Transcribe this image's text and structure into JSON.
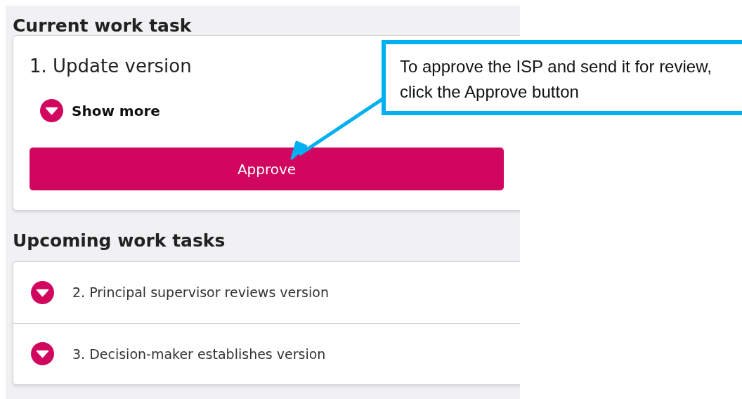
{
  "current_section": {
    "title": "Current work task",
    "task": {
      "title": "1. Update version",
      "toggle_label": "Show more",
      "action_button": "Approve"
    }
  },
  "upcoming_section": {
    "title": "Upcoming work tasks",
    "tasks": [
      {
        "label": "2. Principal supervisor reviews version"
      },
      {
        "label": "3. Decision-maker establishes version"
      }
    ]
  },
  "callout": {
    "text": "To approve the ISP and send it for review, click the Approve button"
  }
}
